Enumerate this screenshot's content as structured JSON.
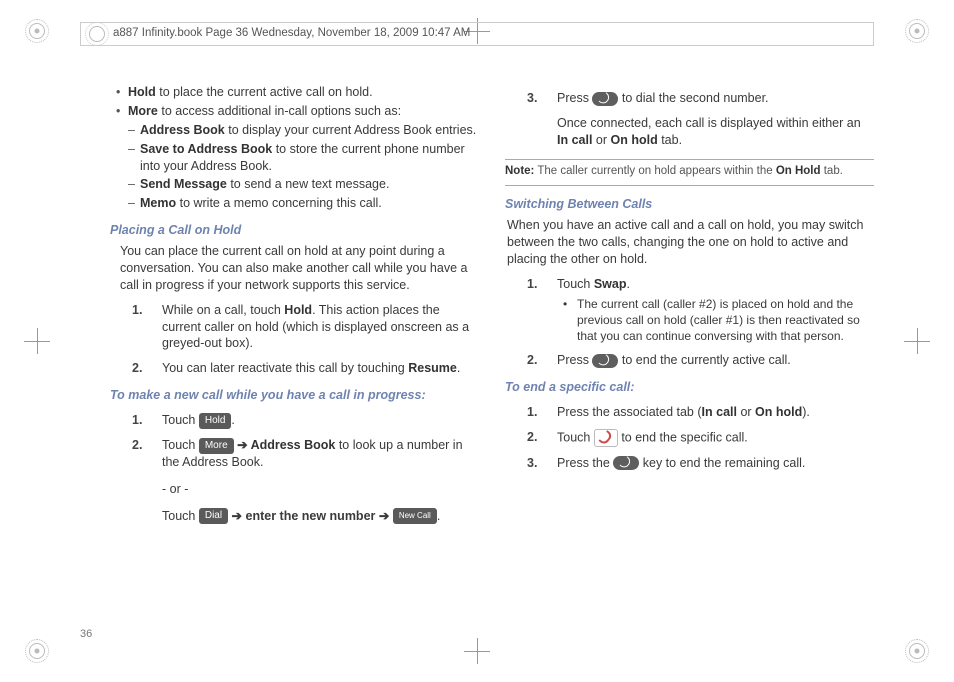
{
  "header": "a887 Infinity.book  Page 36  Wednesday, November 18, 2009  10:47 AM",
  "pageNumber": "36",
  "left": {
    "b1_strong": "Hold",
    "b1_rest": " to place the current active call on hold.",
    "b2_strong": "More",
    "b2_rest": " to access additional in-call options such as:",
    "d1_strong": "Address Book",
    "d1_rest": " to display your current Address Book entries.",
    "d2_strong": "Save to Address Book",
    "d2_rest": " to store the current phone number into your Address Book.",
    "d3_strong": "Send Message",
    "d3_rest": " to send a new text message.",
    "d4_strong": "Memo",
    "d4_rest": " to write a memo concerning this call.",
    "sub1": "Placing a Call on Hold",
    "para1": "You can place the current call on hold at any point during a conversation. You can also make another call while you have a call in progress if your network supports this service.",
    "s1_n1": "1.",
    "s1_t1_a": "While on a call, touch ",
    "s1_t1_b": "Hold",
    "s1_t1_c": ". This action places the current caller on hold (which is displayed onscreen as a greyed-out box).",
    "s1_n2": "2.",
    "s1_t2_a": "You can later reactivate this call by touching ",
    "s1_t2_b": "Resume",
    "s1_t2_c": ".",
    "sub2": "To make a new call while you have a call in progress:",
    "s2_n1": "1.",
    "s2_t1": "Touch ",
    "s2_btn1": "Hold",
    "s2_t1_end": ".",
    "s2_n2": "2.",
    "s2_t2": "Touch ",
    "s2_btn2": "More",
    "s2_t2_arrow": " ➔ ",
    "s2_t2_b": "Address Book",
    "s2_t2_c": " to look up a number in the Address Book.",
    "s2_or": "- or -",
    "s2_t3": "Touch ",
    "s2_btn3": "Dial",
    "s2_t3_mid": " ➔ enter the new number ➔ ",
    "s2_btn4": "New Call",
    "s2_t3_end": "."
  },
  "right": {
    "s3_n": "3.",
    "s3_a": "Press ",
    "s3_b": " to dial the second number.",
    "s3_p2_a": "Once connected, each call is displayed within either an ",
    "s3_p2_b": "In call",
    "s3_p2_c": " or ",
    "s3_p2_d": "On hold",
    "s3_p2_e": " tab.",
    "note_label": "Note:",
    "note_text_a": " The caller currently on hold appears within the ",
    "note_text_b": "On Hold",
    "note_text_c": " tab.",
    "sub3": "Switching Between Calls",
    "para2": "When you have an active call and a call on hold, you may switch between the two calls, changing the one on hold to active and placing the other on hold.",
    "s4_n1": "1.",
    "s4_t1_a": "Touch ",
    "s4_t1_b": "Swap",
    "s4_t1_c": ".",
    "s4_nested": "The current call (caller #2) is placed on hold and the previous call on hold (caller #1) is then reactivated so that you can continue conversing with that person.",
    "s4_n2": "2.",
    "s4_t2_a": "Press ",
    "s4_t2_b": " to end the currently active call.",
    "sub4": "To end a specific call:",
    "s5_n1": "1.",
    "s5_t1_a": "Press the associated tab (",
    "s5_t1_b": "In call",
    "s5_t1_c": " or ",
    "s5_t1_d": "On hold",
    "s5_t1_e": ").",
    "s5_n2": "2.",
    "s5_t2_a": "Touch ",
    "s5_t2_b": " to end the specific call.",
    "s5_n3": "3.",
    "s5_t3_a": "Press the ",
    "s5_t3_b": " key to end the remaining call."
  }
}
